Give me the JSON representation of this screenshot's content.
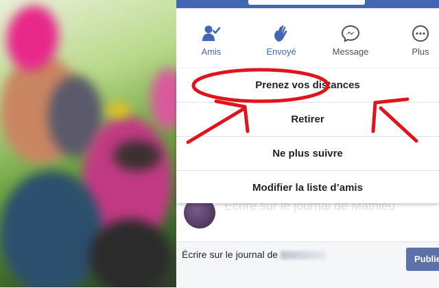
{
  "actions": [
    {
      "label": "Amis",
      "icon": "friends-check-icon"
    },
    {
      "label": "Envoyé",
      "icon": "wave-hand-icon"
    },
    {
      "label": "Message",
      "icon": "messenger-icon"
    },
    {
      "label": "Plus",
      "icon": "more-dots-icon"
    }
  ],
  "menu": {
    "items": [
      "Prenez vos distances",
      "Retirer",
      "Ne plus suivre",
      "Modifier la liste d’amis"
    ]
  },
  "composer": {
    "text": "Écrire sur le journal de",
    "publish_label": "Publie"
  },
  "ghost_text": "Écrire sur le journal de Mathieu",
  "colors": {
    "brand_blue": "#4267b2",
    "annotation_red": "#e0141b",
    "publish_button": "#5b72a8"
  }
}
